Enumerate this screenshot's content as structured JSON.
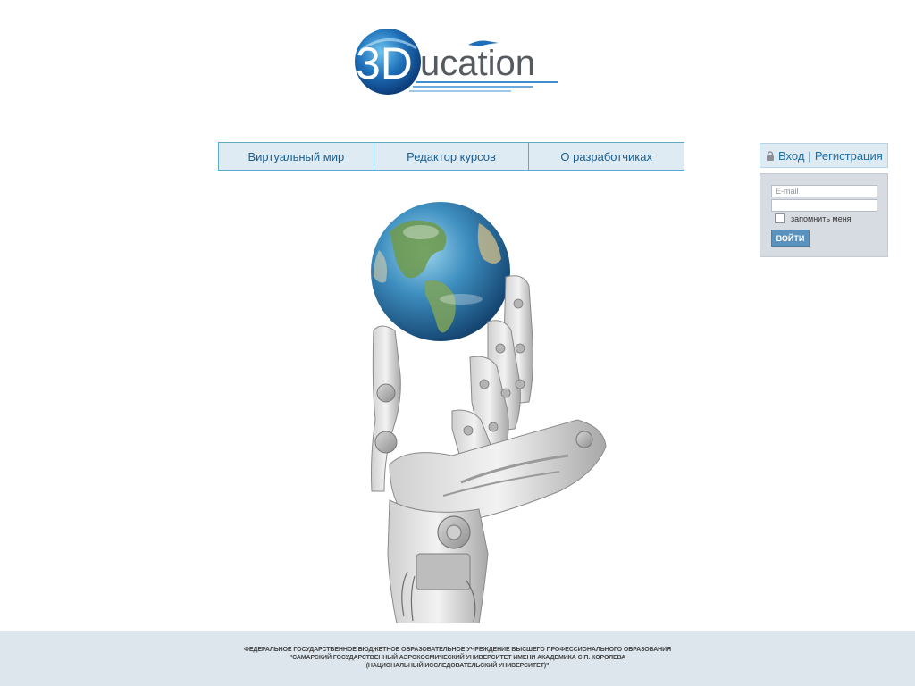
{
  "logo": {
    "text_prefix": "3D",
    "text_suffix": "ucation"
  },
  "nav": {
    "items": [
      {
        "label": "Виртуальный мир"
      },
      {
        "label": "Редактор курсов"
      },
      {
        "label": "О разработчиках"
      }
    ]
  },
  "login": {
    "login_link": "Вход",
    "separator": "|",
    "register_link": "Регистрация",
    "email_placeholder": "E-mail",
    "password_value": "",
    "remember_label": "запомнить меня",
    "remember_checked": false,
    "submit_label": "ВОЙТИ"
  },
  "footer": {
    "line1": "ФЕДЕРАЛЬНОЕ ГОСУДАРСТВЕННОЕ БЮДЖЕТНОЕ ОБРАЗОВАТЕЛЬНОЕ УЧРЕЖДЕНИЕ ВЫСШЕГО ПРОФЕССИОНАЛЬНОГО ОБРАЗОВАНИЯ",
    "line2": "\"САМАРСКИЙ ГОСУДАРСТВЕННЫЙ АЭРОКОСМИЧЕСКИЙ УНИВЕРСИТЕТ ИМЕНИ АКАДЕМИКА С.П. КОРОЛЕВА",
    "line3": "(НАЦИОНАЛЬНЫЙ ИССЛЕДОВАТЕЛЬСКИЙ УНИВЕРСИТЕТ)\""
  },
  "colors": {
    "nav_bg": "#deebf2",
    "nav_border": "#5fa8c8",
    "link": "#1b6fa8",
    "button": "#5b92bd",
    "footer_bg": "#dde6ec"
  }
}
